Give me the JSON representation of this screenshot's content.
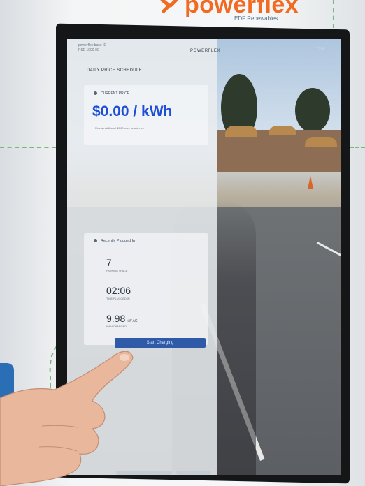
{
  "logo": {
    "word": "powerflex",
    "sub": "EDF Renewables"
  },
  "topbar": {
    "left_line1": "powerflex base ID",
    "left_line2": "PSE 1000-00",
    "brand": "POWERFLEX",
    "right": "12:00"
  },
  "schedule_title": "DAILY PRICE SCHEDULE",
  "current_price": {
    "label": "CURRENT PRICE",
    "value": "$0.00 / kWh",
    "note": "Plus an additional $0.00 once session fee"
  },
  "recent": {
    "title": "Recently Plugged In",
    "stats": [
      {
        "value": "7",
        "unit": "",
        "caption": "PARKING SPACE"
      },
      {
        "value": "02:06",
        "unit": "",
        "caption": "TIME PLUGGED IN"
      },
      {
        "value": "9.98",
        "unit": "kW AC",
        "caption": "KWH CHARGED"
      }
    ]
  },
  "start_button_label": "Start Charging",
  "colors": {
    "brand_orange": "#f26a21",
    "price_blue": "#1d4ed8",
    "button_blue": "#2f5aa8",
    "bezel": "#151617"
  }
}
